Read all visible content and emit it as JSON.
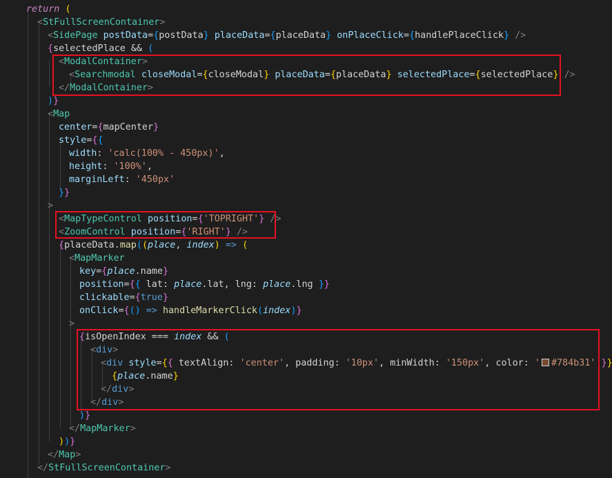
{
  "editor": {
    "swatch_color": "#784b31",
    "lines": [
      {
        "indent": 38,
        "tokens": [
          {
            "t": "return",
            "c": "kw"
          },
          {
            "t": " "
          },
          {
            "t": "(",
            "c": "p1"
          }
        ]
      },
      {
        "indent": 54,
        "tokens": [
          {
            "t": "<",
            "c": "br"
          },
          {
            "t": "StFullScreenContainer",
            "c": "tag"
          },
          {
            "t": ">",
            "c": "br"
          }
        ]
      },
      {
        "indent": 69,
        "tokens": [
          {
            "t": "<",
            "c": "br"
          },
          {
            "t": "SidePage",
            "c": "tag"
          },
          {
            "t": " "
          },
          {
            "t": "postData",
            "c": "attr"
          },
          {
            "t": "=",
            "c": "v"
          },
          {
            "t": "{",
            "c": "p3"
          },
          {
            "t": "postData",
            "c": "v"
          },
          {
            "t": "}",
            "c": "p3"
          },
          {
            "t": " "
          },
          {
            "t": "placeData",
            "c": "attr"
          },
          {
            "t": "=",
            "c": "v"
          },
          {
            "t": "{",
            "c": "p3"
          },
          {
            "t": "placeData",
            "c": "v"
          },
          {
            "t": "}",
            "c": "p3"
          },
          {
            "t": " "
          },
          {
            "t": "onPlaceClick",
            "c": "attr"
          },
          {
            "t": "=",
            "c": "v"
          },
          {
            "t": "{",
            "c": "p3"
          },
          {
            "t": "handlePlaceClick",
            "c": "v"
          },
          {
            "t": "}",
            "c": "p3"
          },
          {
            "t": " "
          },
          {
            "t": "/>",
            "c": "br"
          }
        ]
      },
      {
        "indent": 69,
        "tokens": [
          {
            "t": "{",
            "c": "p2"
          },
          {
            "t": "selectedPlace",
            "c": "v"
          },
          {
            "t": " && ",
            "c": "v"
          },
          {
            "t": "(",
            "c": "p3"
          }
        ]
      },
      {
        "indent": 85,
        "tokens": [
          {
            "t": "<",
            "c": "br"
          },
          {
            "t": "ModalContainer",
            "c": "tag"
          },
          {
            "t": ">",
            "c": "br"
          }
        ]
      },
      {
        "indent": 100,
        "tokens": [
          {
            "t": "<",
            "c": "br"
          },
          {
            "t": "Searchmodal",
            "c": "tag"
          },
          {
            "t": " "
          },
          {
            "t": "closeModal",
            "c": "attr"
          },
          {
            "t": "=",
            "c": "v"
          },
          {
            "t": "{",
            "c": "p1"
          },
          {
            "t": "closeModal",
            "c": "v"
          },
          {
            "t": "}",
            "c": "p1"
          },
          {
            "t": " "
          },
          {
            "t": "placeData",
            "c": "attr"
          },
          {
            "t": "=",
            "c": "v"
          },
          {
            "t": "{",
            "c": "p1"
          },
          {
            "t": "placeData",
            "c": "v"
          },
          {
            "t": "}",
            "c": "p1"
          },
          {
            "t": " "
          },
          {
            "t": "selectedPlace",
            "c": "attr"
          },
          {
            "t": "=",
            "c": "v"
          },
          {
            "t": "{",
            "c": "p1"
          },
          {
            "t": "selectedPlace",
            "c": "v"
          },
          {
            "t": "}",
            "c": "p1"
          },
          {
            "t": " "
          },
          {
            "t": "/>",
            "c": "br"
          }
        ]
      },
      {
        "indent": 85,
        "tokens": [
          {
            "t": "</",
            "c": "br"
          },
          {
            "t": "ModalContainer",
            "c": "tag"
          },
          {
            "t": ">",
            "c": "br"
          }
        ]
      },
      {
        "indent": 69,
        "tokens": [
          {
            "t": ")",
            "c": "p3"
          },
          {
            "t": "}",
            "c": "p2"
          }
        ]
      },
      {
        "indent": 69,
        "tokens": [
          {
            "t": "<",
            "c": "br"
          },
          {
            "t": "Map",
            "c": "tag"
          }
        ]
      },
      {
        "indent": 85,
        "tokens": [
          {
            "t": "center",
            "c": "attr"
          },
          {
            "t": "=",
            "c": "v"
          },
          {
            "t": "{",
            "c": "p2"
          },
          {
            "t": "mapCenter",
            "c": "v"
          },
          {
            "t": "}",
            "c": "p2"
          }
        ]
      },
      {
        "indent": 85,
        "tokens": [
          {
            "t": "style",
            "c": "attr"
          },
          {
            "t": "=",
            "c": "v"
          },
          {
            "t": "{",
            "c": "p2"
          },
          {
            "t": "{",
            "c": "p3"
          }
        ]
      },
      {
        "indent": 100,
        "tokens": [
          {
            "t": "width",
            "c": "prop"
          },
          {
            "t": ": ",
            "c": "v"
          },
          {
            "t": "'calc(100% - 450px)'",
            "c": "str"
          },
          {
            "t": ",",
            "c": "v"
          }
        ]
      },
      {
        "indent": 100,
        "tokens": [
          {
            "t": "height",
            "c": "prop"
          },
          {
            "t": ": ",
            "c": "v"
          },
          {
            "t": "'100%'",
            "c": "str"
          },
          {
            "t": ",",
            "c": "v"
          }
        ]
      },
      {
        "indent": 100,
        "tokens": [
          {
            "t": "marginLeft",
            "c": "prop"
          },
          {
            "t": ": ",
            "c": "v"
          },
          {
            "t": "'450px'",
            "c": "str"
          }
        ]
      },
      {
        "indent": 85,
        "tokens": [
          {
            "t": "}",
            "c": "p3"
          },
          {
            "t": "}",
            "c": "p2"
          }
        ]
      },
      {
        "indent": 69,
        "tokens": [
          {
            "t": ">",
            "c": "br"
          }
        ]
      },
      {
        "indent": 85,
        "tokens": [
          {
            "t": "<",
            "c": "br"
          },
          {
            "t": "MapTypeControl",
            "c": "tag"
          },
          {
            "t": " "
          },
          {
            "t": "position",
            "c": "attr"
          },
          {
            "t": "=",
            "c": "v"
          },
          {
            "t": "{",
            "c": "p2"
          },
          {
            "t": "'TOPRIGHT'",
            "c": "str"
          },
          {
            "t": "}",
            "c": "p2"
          },
          {
            "t": " "
          },
          {
            "t": "/>",
            "c": "br"
          }
        ]
      },
      {
        "indent": 85,
        "tokens": [
          {
            "t": "<",
            "c": "br"
          },
          {
            "t": "ZoomControl",
            "c": "tag"
          },
          {
            "t": " "
          },
          {
            "t": "position",
            "c": "attr"
          },
          {
            "t": "=",
            "c": "v"
          },
          {
            "t": "{",
            "c": "p2"
          },
          {
            "t": "'RIGHT'",
            "c": "str"
          },
          {
            "t": "}",
            "c": "p2"
          },
          {
            "t": " "
          },
          {
            "t": "/>",
            "c": "br"
          }
        ]
      },
      {
        "indent": 85,
        "tokens": [
          {
            "t": "{",
            "c": "p2"
          },
          {
            "t": "placeData",
            "c": "v"
          },
          {
            "t": ".",
            "c": "v"
          },
          {
            "t": "map",
            "c": "fn"
          },
          {
            "t": "(",
            "c": "p3"
          },
          {
            "t": "(",
            "c": "p1"
          },
          {
            "t": "place",
            "c": "prm"
          },
          {
            "t": ", ",
            "c": "v"
          },
          {
            "t": "index",
            "c": "prm"
          },
          {
            "t": ")",
            "c": "p1"
          },
          {
            "t": " => ",
            "c": "lit"
          },
          {
            "t": "(",
            "c": "p1"
          }
        ]
      },
      {
        "indent": 100,
        "tokens": [
          {
            "t": "<",
            "c": "br"
          },
          {
            "t": "MapMarker",
            "c": "tag"
          }
        ]
      },
      {
        "indent": 115,
        "tokens": [
          {
            "t": "key",
            "c": "attr"
          },
          {
            "t": "=",
            "c": "v"
          },
          {
            "t": "{",
            "c": "p2"
          },
          {
            "t": "place",
            "c": "prm"
          },
          {
            "t": ".name",
            "c": "v"
          },
          {
            "t": "}",
            "c": "p2"
          }
        ]
      },
      {
        "indent": 115,
        "tokens": [
          {
            "t": "position",
            "c": "attr"
          },
          {
            "t": "=",
            "c": "v"
          },
          {
            "t": "{",
            "c": "p2"
          },
          {
            "t": "{",
            "c": "p3"
          },
          {
            "t": " lat: ",
            "c": "v"
          },
          {
            "t": "place",
            "c": "prm"
          },
          {
            "t": ".lat, lng: ",
            "c": "v"
          },
          {
            "t": "place",
            "c": "prm"
          },
          {
            "t": ".lng ",
            "c": "v"
          },
          {
            "t": "}",
            "c": "p3"
          },
          {
            "t": "}",
            "c": "p2"
          }
        ]
      },
      {
        "indent": 115,
        "tokens": [
          {
            "t": "clickable",
            "c": "attr"
          },
          {
            "t": "=",
            "c": "v"
          },
          {
            "t": "{",
            "c": "p2"
          },
          {
            "t": "true",
            "c": "lit"
          },
          {
            "t": "}",
            "c": "p2"
          }
        ]
      },
      {
        "indent": 115,
        "tokens": [
          {
            "t": "onClick",
            "c": "attr"
          },
          {
            "t": "=",
            "c": "v"
          },
          {
            "t": "{",
            "c": "p2"
          },
          {
            "t": "(",
            "c": "p3"
          },
          {
            "t": ")",
            "c": "p3"
          },
          {
            "t": " => ",
            "c": "lit"
          },
          {
            "t": "handleMarkerClick",
            "c": "fn"
          },
          {
            "t": "(",
            "c": "p3"
          },
          {
            "t": "index",
            "c": "prm"
          },
          {
            "t": ")",
            "c": "p3"
          },
          {
            "t": "}",
            "c": "p2"
          }
        ]
      },
      {
        "indent": 100,
        "tokens": [
          {
            "t": ">",
            "c": "br"
          }
        ]
      },
      {
        "indent": 115,
        "tokens": [
          {
            "t": "{",
            "c": "p2"
          },
          {
            "t": "isOpenIndex",
            "c": "v"
          },
          {
            "t": " === ",
            "c": "v"
          },
          {
            "t": "index",
            "c": "prm"
          },
          {
            "t": " && ",
            "c": "v"
          },
          {
            "t": "(",
            "c": "p3"
          }
        ]
      },
      {
        "indent": 131,
        "tokens": [
          {
            "t": "<",
            "c": "br"
          },
          {
            "t": "div",
            "c": "lit"
          },
          {
            "t": ">",
            "c": "br"
          }
        ]
      },
      {
        "indent": 146,
        "tokens": [
          {
            "t": "<",
            "c": "br"
          },
          {
            "t": "div",
            "c": "lit"
          },
          {
            "t": " "
          },
          {
            "t": "style",
            "c": "attr"
          },
          {
            "t": "=",
            "c": "v"
          },
          {
            "t": "{",
            "c": "p1"
          },
          {
            "t": "{",
            "c": "p2"
          },
          {
            "t": " textAlign: ",
            "c": "v"
          },
          {
            "t": "'center'",
            "c": "str"
          },
          {
            "t": ", padding: ",
            "c": "v"
          },
          {
            "t": "'10px'",
            "c": "str"
          },
          {
            "t": ", minWidth: ",
            "c": "v"
          },
          {
            "t": "'150px'",
            "c": "str"
          },
          {
            "t": ", color: ",
            "c": "v"
          },
          {
            "t": "'",
            "c": "str"
          },
          {
            "t": "",
            "c": "swatch"
          },
          {
            "t": "#784b31'",
            "c": "str"
          },
          {
            "t": " "
          },
          {
            "t": "}",
            "c": "p2"
          },
          {
            "t": "}",
            "c": "p1"
          },
          {
            "t": ">",
            "c": "br"
          }
        ]
      },
      {
        "indent": 162,
        "tokens": [
          {
            "t": "{",
            "c": "p1"
          },
          {
            "t": "place",
            "c": "prm"
          },
          {
            "t": ".name",
            "c": "v"
          },
          {
            "t": "}",
            "c": "p1"
          }
        ]
      },
      {
        "indent": 146,
        "tokens": [
          {
            "t": "</",
            "c": "br"
          },
          {
            "t": "div",
            "c": "lit"
          },
          {
            "t": ">",
            "c": "br"
          }
        ]
      },
      {
        "indent": 131,
        "tokens": [
          {
            "t": "</",
            "c": "br"
          },
          {
            "t": "div",
            "c": "lit"
          },
          {
            "t": ">",
            "c": "br"
          }
        ]
      },
      {
        "indent": 115,
        "tokens": [
          {
            "t": ")",
            "c": "p3"
          },
          {
            "t": "}",
            "c": "p2"
          }
        ]
      },
      {
        "indent": 100,
        "tokens": [
          {
            "t": "</",
            "c": "br"
          },
          {
            "t": "MapMarker",
            "c": "tag"
          },
          {
            "t": ">",
            "c": "br"
          }
        ]
      },
      {
        "indent": 85,
        "tokens": [
          {
            "t": ")",
            "c": "p1"
          },
          {
            "t": ")",
            "c": "p3"
          },
          {
            "t": "}",
            "c": "p2"
          }
        ]
      },
      {
        "indent": 69,
        "tokens": [
          {
            "t": "</",
            "c": "br"
          },
          {
            "t": "Map",
            "c": "tag"
          },
          {
            "t": ">",
            "c": "br"
          }
        ]
      },
      {
        "indent": 54,
        "tokens": [
          {
            "t": "</",
            "c": "br"
          },
          {
            "t": "StFullScreenContainer",
            "c": "tag"
          },
          {
            "t": ">",
            "c": "br"
          }
        ]
      }
    ]
  }
}
